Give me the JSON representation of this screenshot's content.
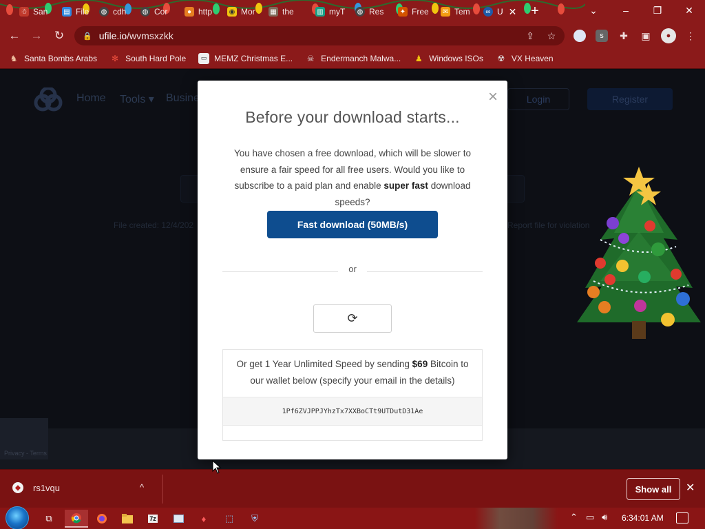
{
  "browser": {
    "tabs": [
      {
        "label": "San",
        "icon": "santa-icon",
        "color": "#c0392b"
      },
      {
        "label": "File",
        "icon": "file-icon",
        "color": "#2e86de"
      },
      {
        "label": "cdh",
        "icon": "globe-icon",
        "color": "#555555"
      },
      {
        "label": "Cor",
        "icon": "globe-icon",
        "color": "#555555"
      },
      {
        "label": "http",
        "icon": "bomb-icon",
        "color": "#e67e22"
      },
      {
        "label": "Mor",
        "icon": "compass-icon",
        "color": "#f1c40f"
      },
      {
        "label": "the",
        "icon": "image-icon",
        "color": "#7f6a5a"
      },
      {
        "label": "myT",
        "icon": "page-icon",
        "color": "#16a085"
      },
      {
        "label": "Res",
        "icon": "globe-icon",
        "color": "#555555"
      },
      {
        "label": "Free",
        "icon": "gift-icon",
        "color": "#d35400"
      },
      {
        "label": "Tem",
        "icon": "envelope-icon",
        "color": "#f39c12"
      },
      {
        "label": "U",
        "icon": "ufile-icon",
        "color": "#1e5aa8"
      }
    ],
    "window_controls": {
      "minimize": "–",
      "restore": "❐",
      "close": "✕",
      "tab_search": "⌄"
    },
    "address": {
      "host": "ufile.io",
      "path": "/wvmsxzkk"
    },
    "bookmarks": [
      {
        "label": "Santa Bombs Arabs",
        "icon": "santa-icon"
      },
      {
        "label": "South Hard Pole",
        "icon": "snowflake-icon"
      },
      {
        "label": "MEMZ Christmas E...",
        "icon": "window-icon"
      },
      {
        "label": "Endermanch Malwa...",
        "icon": "skull-icon"
      },
      {
        "label": "Windows ISOs",
        "icon": "figure-icon"
      },
      {
        "label": "VX Heaven",
        "icon": "vx-icon"
      }
    ]
  },
  "page": {
    "nav": {
      "home": "Home",
      "tools": "Tools ▾",
      "business": "Busine",
      "login": "Login",
      "register": "Register"
    },
    "file_created": "File created: 12/4/202",
    "report": "Report file for violation",
    "recaptcha": "Privacy - Terms"
  },
  "modal": {
    "close": "×",
    "title": "Before your download starts...",
    "text_before": "You have chosen a free download, which will be slower to ensure a fair speed for all free users. Would you like to subscribe to a paid plan and enable ",
    "text_bold": "super fast",
    "text_after": " download speeds?",
    "fast_button": "Fast download (50MB/s)",
    "or": "or",
    "captcha_icon": "⟳",
    "btc_before": "Or get 1 Year Unlimited Speed by sending ",
    "btc_price": "$69",
    "btc_after": " Bitcoin to our wallet below (specify your email in the details)",
    "wallet": "1Pf6ZVJPPJYhzTx7XXBoCTt9UTDutD31Ae"
  },
  "download_bar": {
    "filename": "rs1vqu",
    "chevron": "^",
    "show_all": "Show all",
    "close": "✕"
  },
  "taskbar": {
    "clock": "6:34:01 AM",
    "apps": [
      "task-view",
      "chrome",
      "firefox",
      "file-explorer",
      "7zip",
      "window-app",
      "red-app",
      "install-app",
      "shield-app"
    ]
  },
  "colors": {
    "chrome_theme": "#8b1a1a",
    "modal_button": "#0e4d8f",
    "taskbar": "#8a1515"
  }
}
